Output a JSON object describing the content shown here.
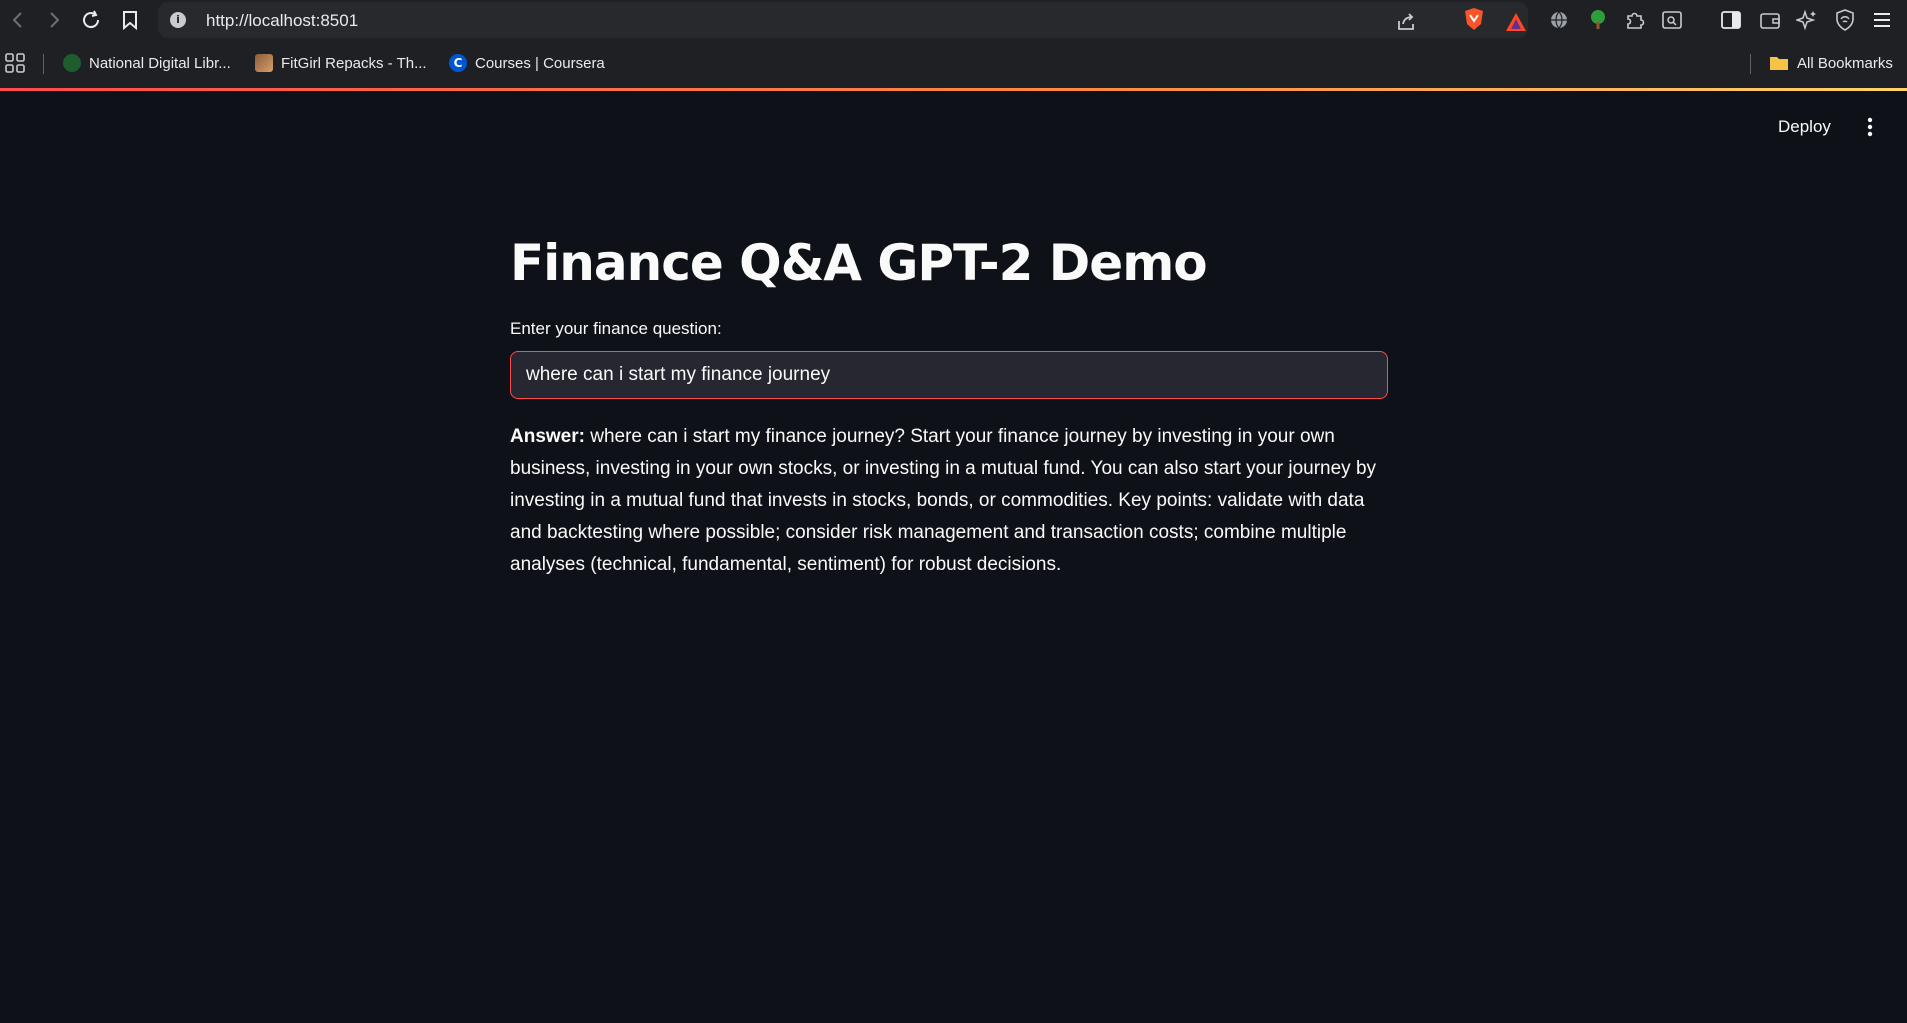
{
  "browser": {
    "url": "http://localhost:8501",
    "bookmarks": [
      {
        "label": "National Digital Libr...",
        "icon": "ndl-favicon"
      },
      {
        "label": "FitGirl Repacks - Th...",
        "icon": "fitgirl-favicon"
      },
      {
        "label": "Courses | Coursera",
        "icon": "coursera-favicon"
      }
    ],
    "all_bookmarks_label": "All Bookmarks"
  },
  "header": {
    "deploy_label": "Deploy"
  },
  "main": {
    "title": "Finance Q&A GPT-2 Demo",
    "input_label": "Enter your finance question:",
    "question_value": "where can i start my finance journey",
    "answer_prefix": "Answer:",
    "answer_text": "where can i start my finance journey? Start your finance journey by investing in your own business, investing in your own stocks, or investing in a mutual fund. You can also start your journey by investing in a mutual fund that invests in stocks, bonds, or commodities. Key points: validate with data and backtesting where possible; consider risk management and transaction costs; combine multiple analyses (technical, fundamental, sentiment) for robust decisions."
  },
  "colors": {
    "app_background": "#0e1117",
    "input_border": "#ff4b4b",
    "input_background": "#262730",
    "browser_chrome": "#1f2023"
  }
}
